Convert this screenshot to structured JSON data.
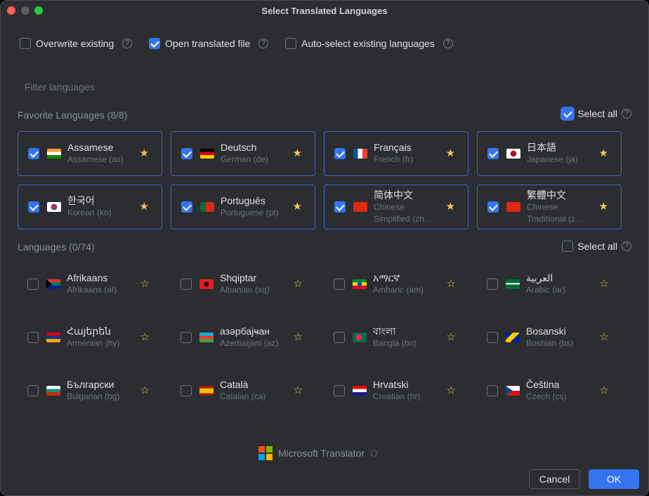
{
  "window": {
    "title": "Select Translated Languages"
  },
  "options": [
    {
      "label": "Overwrite existing",
      "checked": false
    },
    {
      "label": "Open translated file",
      "checked": true
    },
    {
      "label": "Auto-select existing languages",
      "checked": false
    }
  ],
  "filter": {
    "placeholder": "Filter languages",
    "value": ""
  },
  "favorites": {
    "title": "Favorite Languages (8/8)",
    "select_all_label": "Select all",
    "select_all_checked": true,
    "items": [
      {
        "name": "Assamese",
        "sub": "Assamese (as)",
        "flag": "india-flag",
        "checked": true,
        "favorite": true
      },
      {
        "name": "Deutsch",
        "sub": "German (de)",
        "flag": "germany-flag",
        "checked": true,
        "favorite": true
      },
      {
        "name": "Français",
        "sub": "French (fr)",
        "flag": "france-flag",
        "checked": true,
        "favorite": true
      },
      {
        "name": "日本語",
        "sub": "Japanese (ja)",
        "flag": "japan-flag",
        "checked": true,
        "favorite": true
      },
      {
        "name": "한국어",
        "sub": "Korean (ko)",
        "flag": "korea-flag",
        "checked": true,
        "favorite": true
      },
      {
        "name": "Português",
        "sub": "Portuguese (pt)",
        "flag": "portugal-flag",
        "checked": true,
        "favorite": true
      },
      {
        "name": "简体中文",
        "sub": "Chinese Simplified (zh…",
        "flag": "china-flag",
        "checked": true,
        "favorite": true
      },
      {
        "name": "繁體中文",
        "sub": "Chinese Traditional (z…",
        "flag": "china-flag",
        "checked": true,
        "favorite": true
      }
    ]
  },
  "languages": {
    "title": "Languages (0/74)",
    "select_all_label": "Select all",
    "select_all_checked": false,
    "items": [
      {
        "name": "Afrikaans",
        "sub": "Afrikaans (af)",
        "flag": "south-africa-flag",
        "checked": false,
        "favorite": false
      },
      {
        "name": "Shqiptar",
        "sub": "Albanian (sq)",
        "flag": "albania-flag",
        "checked": false,
        "favorite": false
      },
      {
        "name": "አማርኛ",
        "sub": "Amharic (am)",
        "flag": "ethiopia-flag",
        "checked": false,
        "favorite": false
      },
      {
        "name": "العربية",
        "sub": "Arabic (ar)",
        "flag": "saudi-arabia-flag",
        "checked": false,
        "favorite": false
      },
      {
        "name": "Հայերեն",
        "sub": "Armenian (hy)",
        "flag": "armenia-flag",
        "checked": false,
        "favorite": false
      },
      {
        "name": "азәрбајҹан",
        "sub": "Azerbaijani (az)",
        "flag": "azerbaijan-flag",
        "checked": false,
        "favorite": false
      },
      {
        "name": "বাংলা",
        "sub": "Bangla (bn)",
        "flag": "bangladesh-flag",
        "checked": false,
        "favorite": false
      },
      {
        "name": "Bosanski",
        "sub": "Bosnian (bs)",
        "flag": "bosnia-flag",
        "checked": false,
        "favorite": false
      },
      {
        "name": "Български",
        "sub": "Bulgarian (bg)",
        "flag": "bulgaria-flag",
        "checked": false,
        "favorite": false
      },
      {
        "name": "Català",
        "sub": "Catalan (ca)",
        "flag": "spain-flag",
        "checked": false,
        "favorite": false
      },
      {
        "name": "Hrvatski",
        "sub": "Croatian (hr)",
        "flag": "croatia-flag",
        "checked": false,
        "favorite": false
      },
      {
        "name": "Čeština",
        "sub": "Czech (cs)",
        "flag": "czech-flag",
        "checked": false,
        "favorite": false
      }
    ]
  },
  "footer": {
    "brand": "Microsoft Translator",
    "cancel_label": "Cancel",
    "ok_label": "OK"
  }
}
